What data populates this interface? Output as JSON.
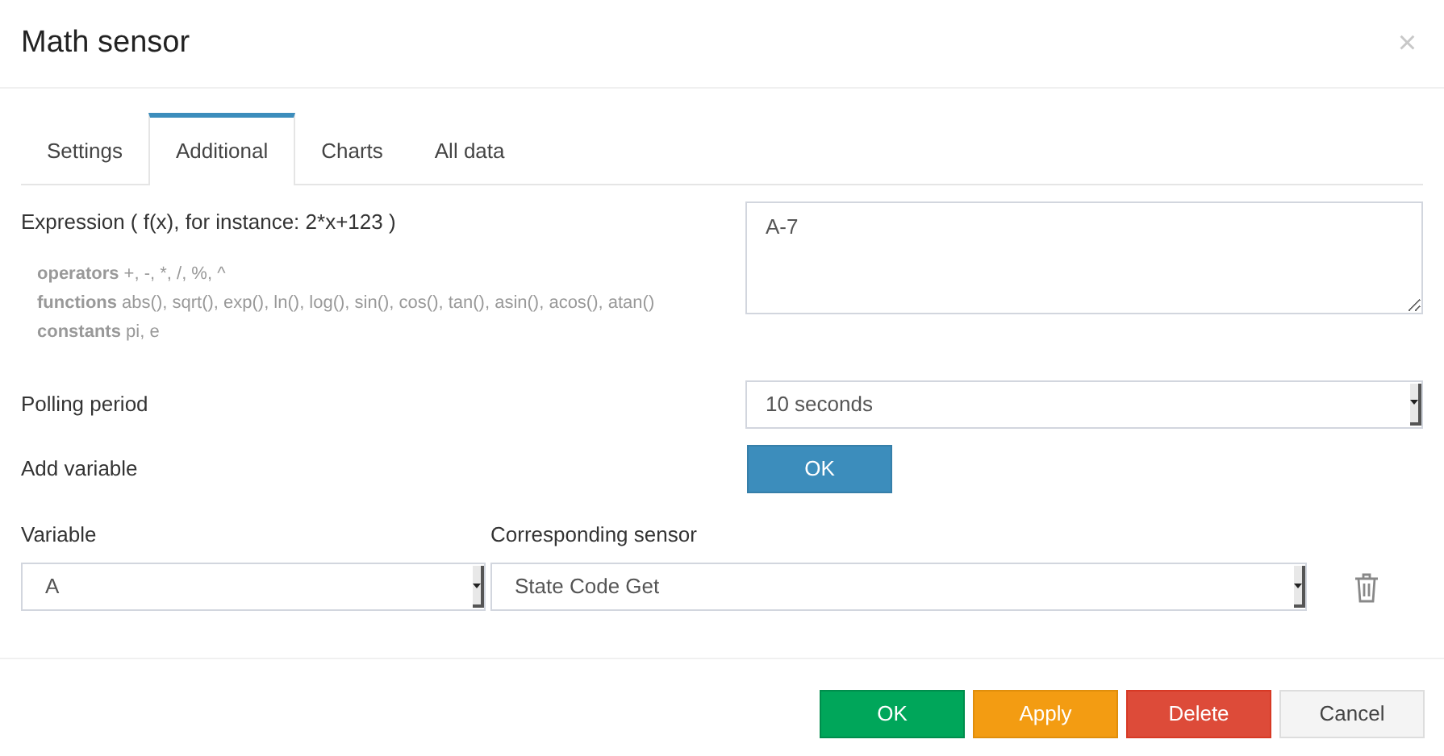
{
  "window": {
    "title": "Math sensor",
    "close": "×"
  },
  "tabs": [
    {
      "label": "Settings",
      "selected": false
    },
    {
      "label": "Additional",
      "selected": true
    },
    {
      "label": "Charts",
      "selected": false
    },
    {
      "label": "All data",
      "selected": false
    }
  ],
  "expression": {
    "label": "Expression ( f(x), for instance: 2*x+123 )",
    "value": "A-7",
    "hints": [
      "**operators** +, -, *, /, %, ^",
      "**functions** abs(), sqrt(), exp(), ln(), log(), sin(), cos(), tan(), asin(), acos(), atan()",
      "**constants** pi, e"
    ]
  },
  "polling": {
    "label": "Polling period",
    "value": "10 seconds"
  },
  "add_variable": {
    "label": "Add variable",
    "button": "OK"
  },
  "variables": {
    "columns": [
      "Variable",
      "Corresponding sensor"
    ],
    "rows": [
      {
        "variable": "A",
        "sensor": "State Code Get"
      }
    ]
  },
  "footer_buttons": [
    {
      "label": "OK",
      "kind": "success"
    },
    {
      "label": "Apply",
      "kind": "warning"
    },
    {
      "label": "Delete",
      "kind": "danger"
    },
    {
      "label": "Cancel",
      "kind": "default"
    }
  ]
}
